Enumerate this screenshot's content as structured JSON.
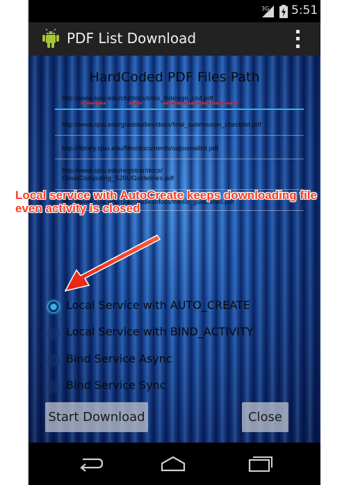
{
  "status_bar": {
    "network": "3G",
    "time": "5:51"
  },
  "action_bar": {
    "title": "PDF List Download",
    "app_icon": "android-icon",
    "menu_icon": "overflow-menu-icon"
  },
  "content": {
    "heading": "HardCoded PDF Files Path",
    "paths": [
      "http://www.sjsu.edu/cfd/docs/intro_indesign_cs4.pdf",
      "http://www.sjsu.edu/gradstudies/docs/final_submission_checklist.pdf",
      "http://library.sjsu.edu/files/documents/oajournallist.pdf",
      "http://www.sjsu.edu/registrar/docs/",
      "CloudComputing_SJSUGuidelines.pdf",
      "http://www.sjsu.edu/gradstudies/docs/thesis_guidelines.pdf"
    ],
    "options": [
      {
        "label": "Local Service with AUTO_CREATE",
        "checked": true
      },
      {
        "label": "Local Service with BIND_ACTIVITY",
        "checked": false
      },
      {
        "label": "Bind Service Async",
        "checked": false
      },
      {
        "label": "Bind Service Sync",
        "checked": false
      }
    ],
    "start_button": "Start Download",
    "close_button": "Close"
  },
  "annotation": {
    "line1": "Local service with AutoCreate keeps downloading file",
    "line2": "even activity is closed",
    "color": "#ff3b1f"
  },
  "nav_bar": {
    "back_icon": "back-icon",
    "home_icon": "home-icon",
    "recents_icon": "recents-icon"
  },
  "colors": {
    "accent": "#33b5e5",
    "action_bar": "#222222"
  }
}
